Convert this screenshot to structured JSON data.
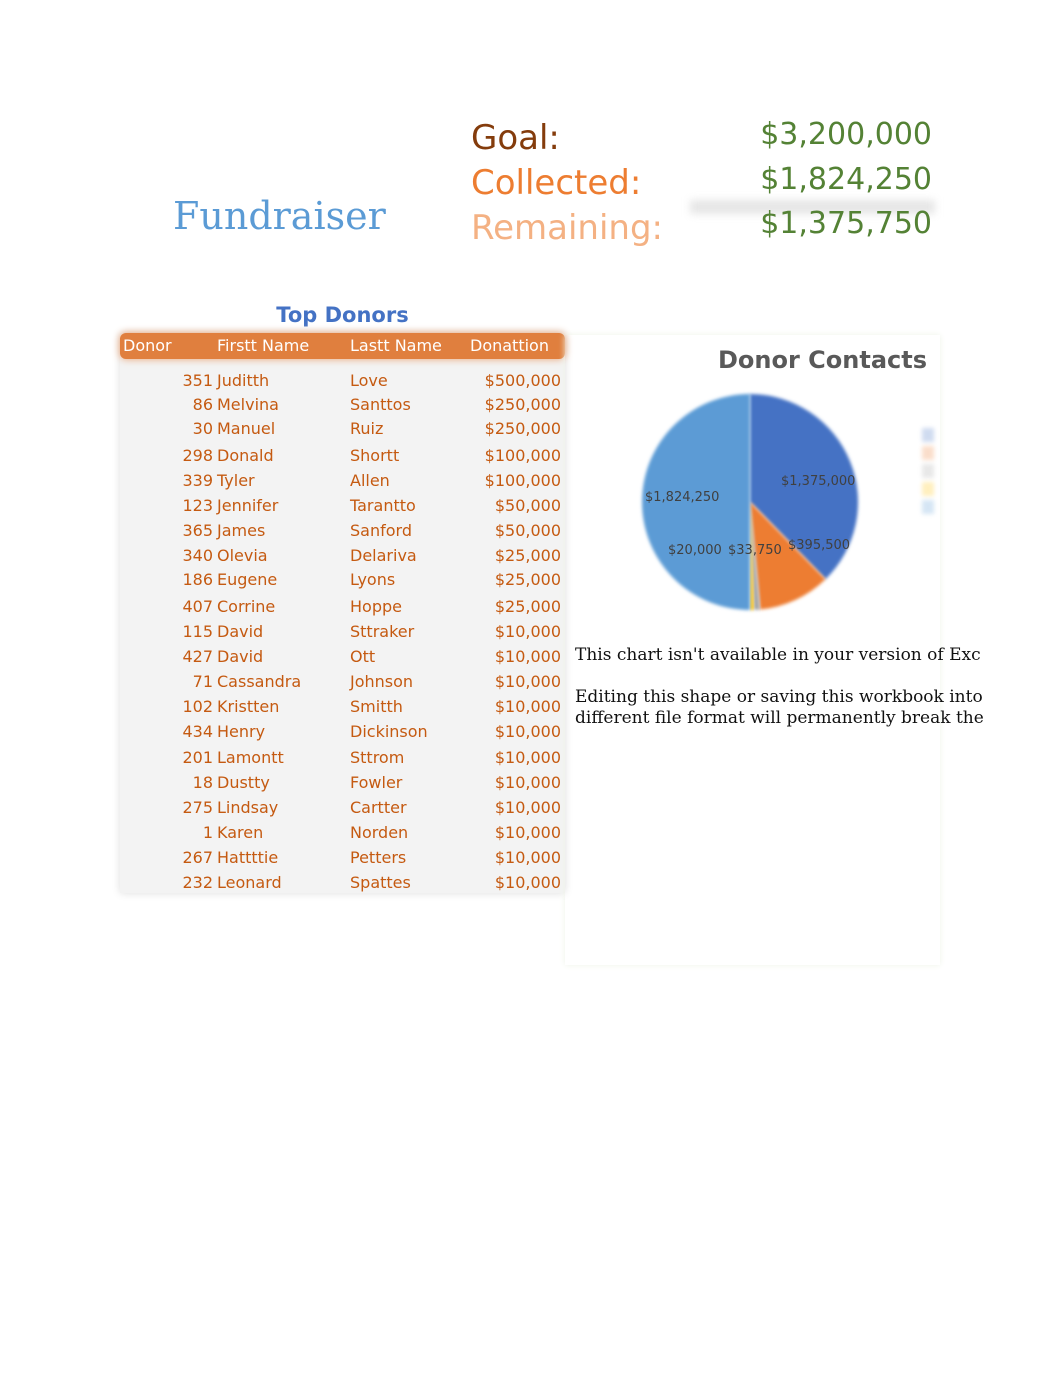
{
  "header": {
    "title": "Fundraiser",
    "goal_label": "Goal:",
    "goal_value": "$3,200,000",
    "collected_label": "Collected:",
    "collected_value": "$1,824,250",
    "remaining_label": "Remaining:",
    "remaining_value": "$1,375,750"
  },
  "colors": {
    "title": "#5b9bd5",
    "goal": "#843c0c",
    "collected": "#ed7d31",
    "remaining": "#f4b183",
    "values": "#548235",
    "table_header": "#e07f3e",
    "table_text": "#c55a11"
  },
  "top_donors": {
    "title": "Top Donors",
    "columns": [
      "Donor",
      "Firstt Name",
      "Lastt Name",
      "Donattion"
    ],
    "rows": [
      [
        "351",
        "Juditth",
        "Love",
        "$500,000"
      ],
      [
        "86",
        "Melvina",
        "Santtos",
        "$250,000"
      ],
      [
        "30",
        "Manuel",
        "Ruiz",
        "$250,000"
      ],
      [
        "298",
        "Donald",
        "Shortt",
        "$100,000"
      ],
      [
        "339",
        "Tyler",
        "Allen",
        "$100,000"
      ],
      [
        "123",
        "Jennifer",
        "Tarantto",
        "$50,000"
      ],
      [
        "365",
        "James",
        "Sanford",
        "$50,000"
      ],
      [
        "340",
        "Olevia",
        "Delariva",
        "$25,000"
      ],
      [
        "186",
        "Eugene",
        "Lyons",
        "$25,000"
      ],
      [
        "407",
        "Corrine",
        "Hoppe",
        "$25,000"
      ],
      [
        "115",
        "David",
        "Sttraker",
        "$10,000"
      ],
      [
        "427",
        "David",
        "Ott",
        "$10,000"
      ],
      [
        "71",
        "Cassandra",
        "Johnson",
        "$10,000"
      ],
      [
        "102",
        "Kristten",
        "Smitth",
        "$10,000"
      ],
      [
        "434",
        "Henry",
        "Dickinson",
        "$10,000"
      ],
      [
        "201",
        "Lamontt",
        "Sttrom",
        "$10,000"
      ],
      [
        "18",
        "Dustty",
        "Fowler",
        "$10,000"
      ],
      [
        "275",
        "Lindsay",
        "Cartter",
        "$10,000"
      ],
      [
        "1",
        "Karen",
        "Norden",
        "$10,000"
      ],
      [
        "267",
        "Hattttie",
        "Petters",
        "$10,000"
      ],
      [
        "232",
        "Leonard",
        "Spattes",
        "$10,000"
      ]
    ]
  },
  "chart_data": {
    "type": "pie",
    "title": "Donor Contacts",
    "slices": [
      {
        "label": "$1,375,000",
        "value": 1375000,
        "color": "#4472c4"
      },
      {
        "label": "$395,500",
        "value": 395500,
        "color": "#ed7d31"
      },
      {
        "label": "$33,750",
        "value": 33750,
        "color": "#a5a5a5"
      },
      {
        "label": "$20,000",
        "value": 20000,
        "color": "#ffc000"
      },
      {
        "label": "$1,824,250",
        "value": 1824250,
        "color": "#5b9bd5"
      }
    ],
    "legend_placement": "right"
  },
  "chart_message": {
    "line1": "This chart isn't available in your version of Exc",
    "line2": "Editing this shape or saving this workbook into",
    "line3": "different file format will permanently break the"
  }
}
